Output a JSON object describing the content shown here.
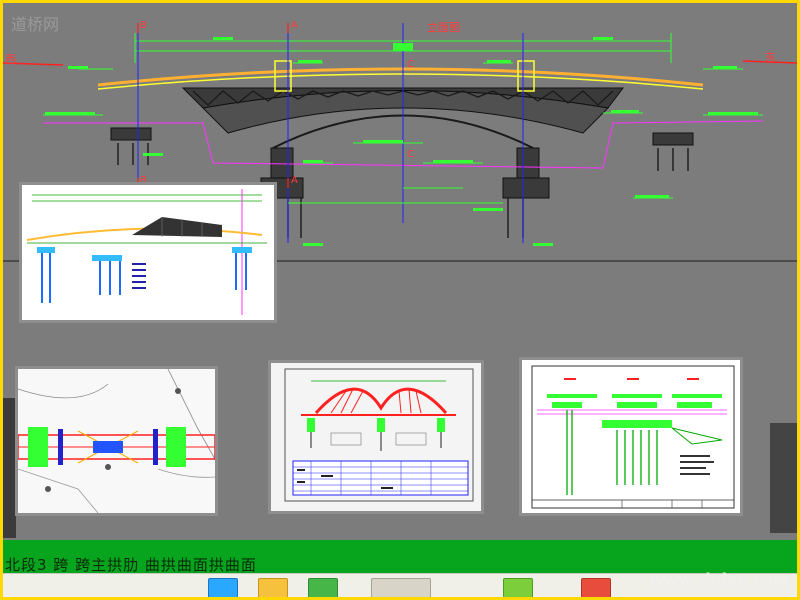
{
  "watermarks": {
    "top_left": "道桥网",
    "bottom_right": "www.chdao.com"
  },
  "elevation": {
    "title": "立面图",
    "section_marks": [
      "A",
      "B",
      "C"
    ],
    "direction_left": "西",
    "direction_right": "东"
  },
  "bottom_strip": {
    "text": "北段3 跨  跨主拱肋 曲拱曲面拱曲面"
  },
  "colors": {
    "background": "#7c7c7c",
    "frame": "#ffd800",
    "cad_green": "#33ff33",
    "cad_yellow": "#ffff33",
    "cad_magenta": "#ff33ff",
    "cad_red": "#ff2020",
    "cad_blue": "#2020ff",
    "strip": "#06a51d"
  },
  "thumbnails": [
    {
      "name": "elevation-overview-drawing"
    },
    {
      "name": "plan-view-drawing"
    },
    {
      "name": "arch-rib-elevation-drawing"
    },
    {
      "name": "cross-section-drawing"
    }
  ],
  "taskbar": {
    "icons": [
      "app-icon",
      "folder-icon",
      "browser-icon",
      "media-icon",
      "tool-icon",
      "paint-icon"
    ]
  }
}
